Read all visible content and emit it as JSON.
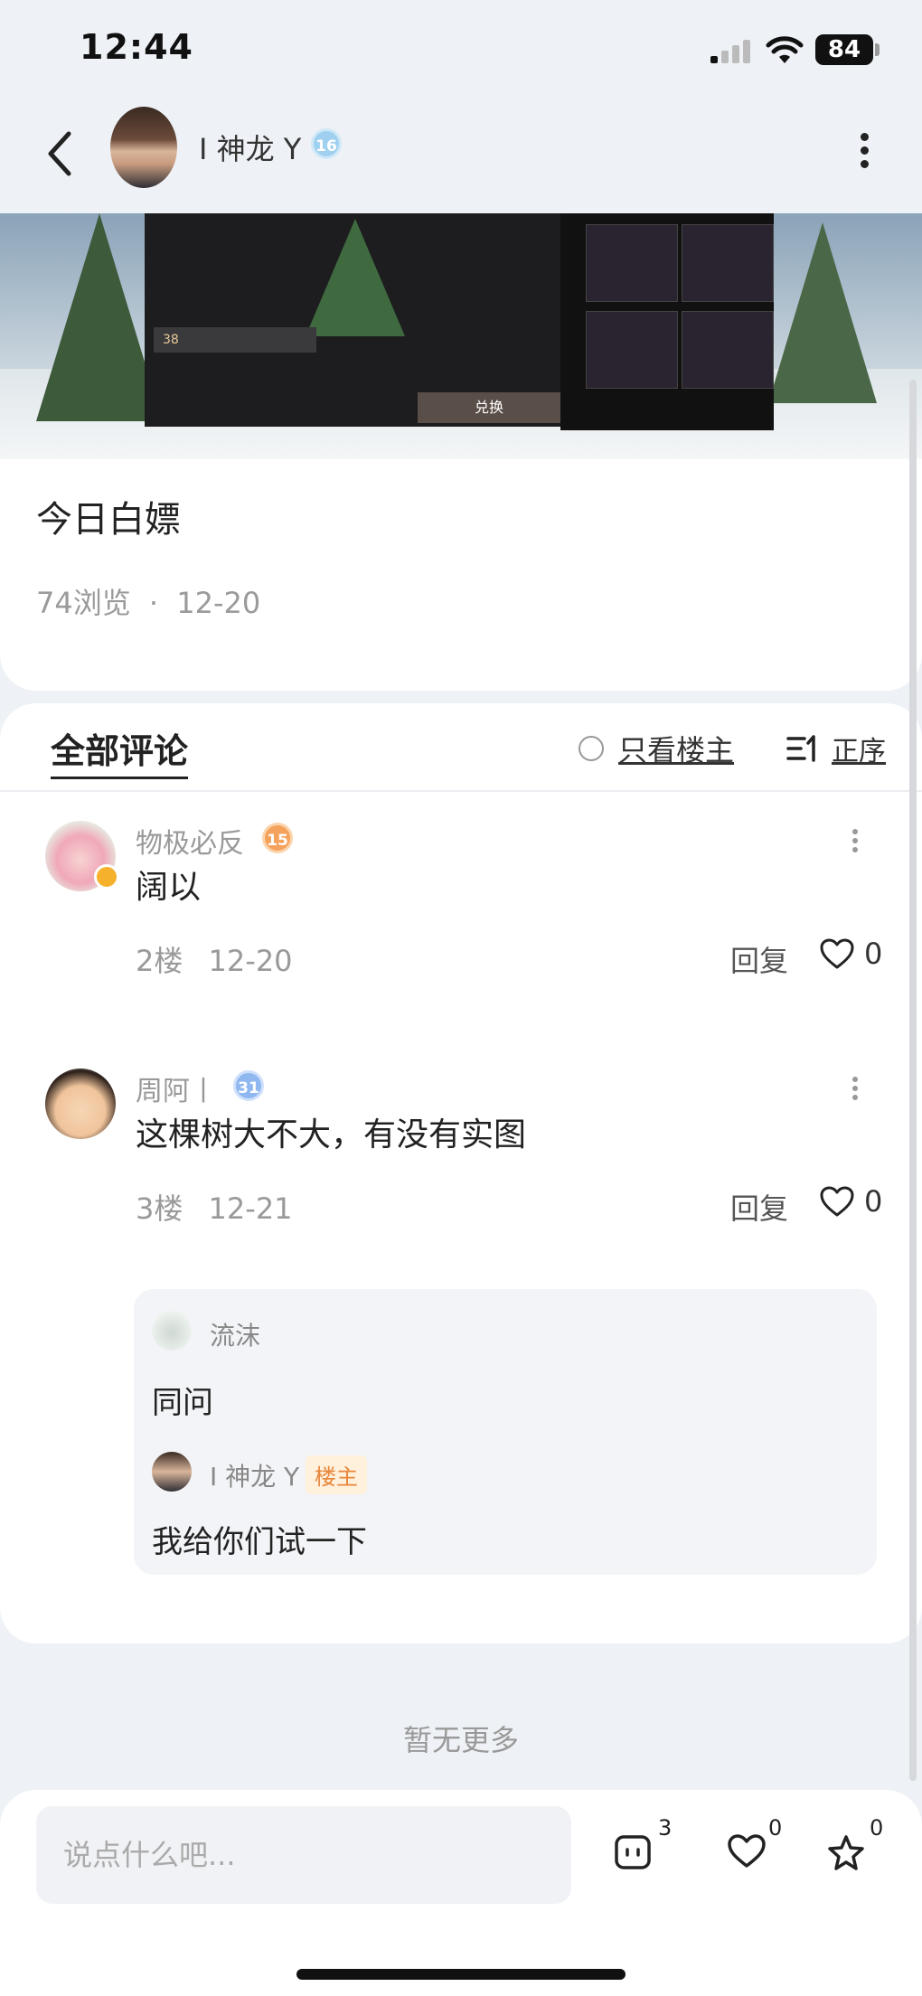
{
  "status_bar": {
    "time": "12:44",
    "battery": "84"
  },
  "header": {
    "author": "I 神龙 Y",
    "level": "16"
  },
  "banner": {
    "price": "38",
    "redeem_label": "兑换"
  },
  "post": {
    "title": "今日白嫖",
    "views": "74浏览",
    "dot": "·",
    "date": "12-20"
  },
  "comments_section": {
    "tab_all": "全部评论",
    "filter_owner": "只看楼主",
    "sort_label": "正序"
  },
  "comments": [
    {
      "name": "物极必反",
      "level": "15",
      "text": "阔以",
      "floor": "2楼",
      "date": "12-20",
      "reply": "回复",
      "likes": "0"
    },
    {
      "name": "周阿丨",
      "level": "31",
      "text": "这棵树大不大，有没有实图",
      "floor": "3楼",
      "date": "12-21",
      "reply": "回复",
      "likes": "0"
    }
  ],
  "sub_replies": [
    {
      "name": "流沫",
      "text": "同问"
    },
    {
      "name": "I 神龙 Y",
      "tag": "楼主",
      "text": "我给你们试一下"
    }
  ],
  "no_more": "暂无更多",
  "bottom_bar": {
    "input_placeholder": "说点什么吧...",
    "comment_count": "3",
    "like_count": "0",
    "fav_count": "0"
  },
  "icons": [
    "back-icon",
    "more-icon",
    "radio-icon",
    "sort-icon",
    "heart-icon",
    "comment-icon",
    "star-icon",
    "wifi-icon",
    "signal-icon"
  ]
}
